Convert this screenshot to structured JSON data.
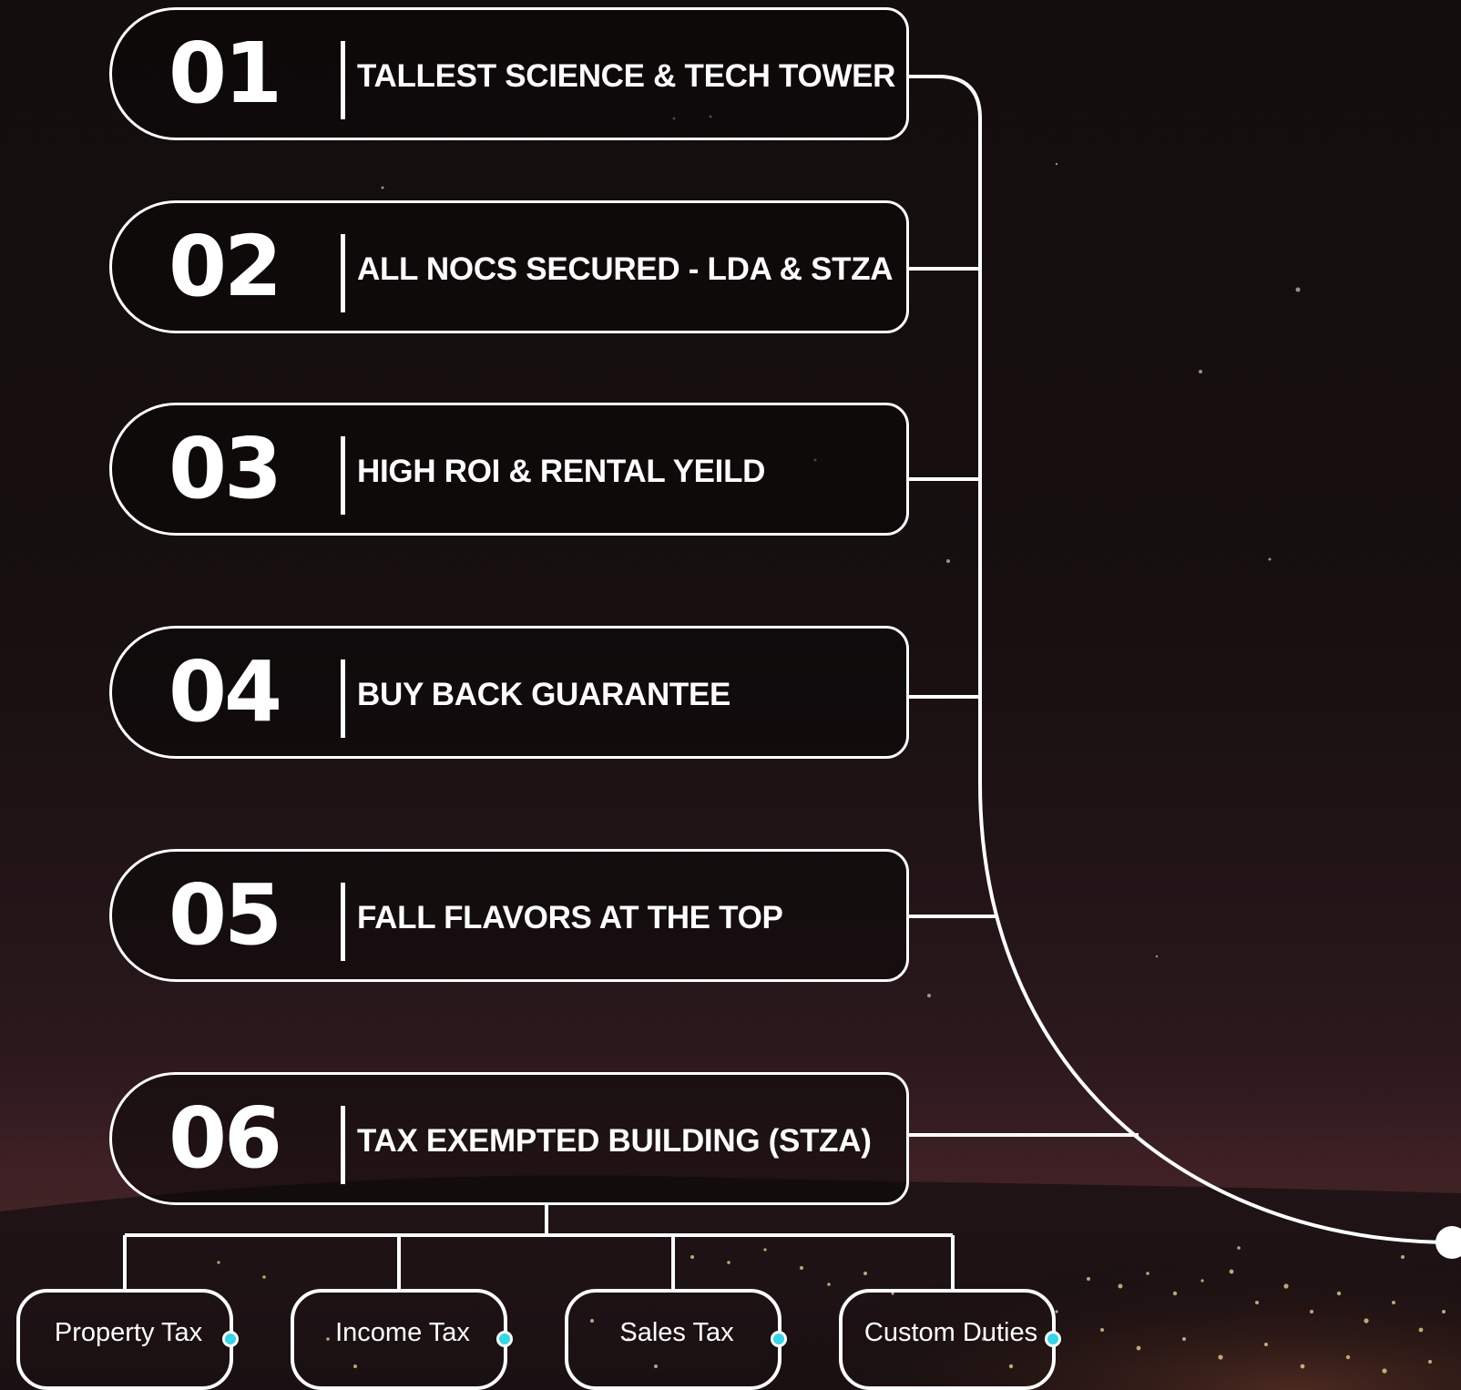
{
  "colors": {
    "line": "#ffffff",
    "accent_dot": "#34d6e8",
    "background_top": "#130d0d",
    "background_bottom": "#3a2025"
  },
  "features": [
    {
      "number": "01",
      "label": "TALLEST SCIENCE & TECH TOWER"
    },
    {
      "number": "02",
      "label": "ALL NOCS SECURED - LDA & STZA"
    },
    {
      "number": "03",
      "label": "HIGH ROI & RENTAL YEILD"
    },
    {
      "number": "04",
      "label": "BUY BACK GUARANTEE"
    },
    {
      "number": "05",
      "label": "FALL FLAVORS AT THE TOP"
    },
    {
      "number": "06",
      "label": "TAX EXEMPTED BUILDING (STZA)"
    }
  ],
  "tax_items": [
    {
      "label": "Property Tax"
    },
    {
      "label": "Income Tax"
    },
    {
      "label": "Sales Tax"
    },
    {
      "label": "Custom Duties"
    }
  ]
}
